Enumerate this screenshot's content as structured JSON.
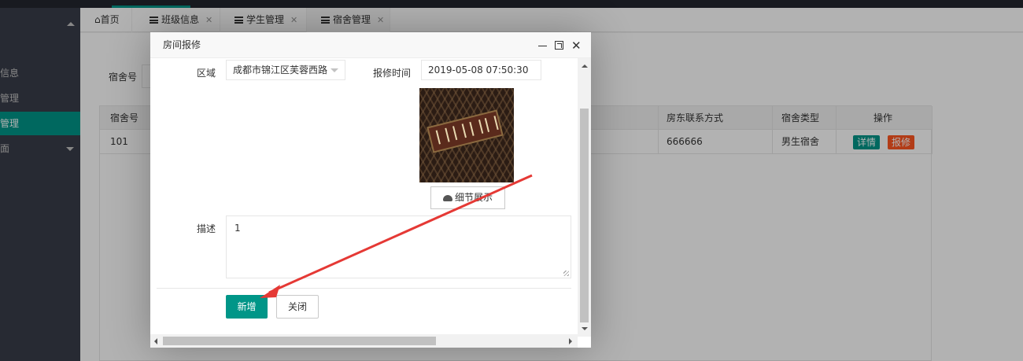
{
  "tabs": [
    {
      "label": "首页",
      "icon": "home-icon"
    },
    {
      "label": "班级信息",
      "icon": "list-icon"
    },
    {
      "label": "学生管理",
      "icon": "list-icon"
    },
    {
      "label": "宿舍管理",
      "icon": "list-icon"
    }
  ],
  "tab_close_glyph": "✕",
  "sidebar": {
    "items": [
      {
        "label": "信息"
      },
      {
        "label": "管理"
      },
      {
        "label": "管理"
      },
      {
        "label": "面"
      }
    ]
  },
  "page": {
    "search_label": "宿舍号",
    "table": {
      "headers": {
        "col1": "宿舍号",
        "col_landlord": "房东联系方式",
        "col_type": "宿舍类型",
        "col_ops": "操作"
      },
      "rows": [
        {
          "dorm_no": "101",
          "landlord_contact": "666666",
          "dorm_type": "男生宿舍",
          "detail_label": "详情",
          "repair_label": "报修"
        }
      ]
    }
  },
  "modal": {
    "title": "房间报修",
    "fields": {
      "area_label": "区域",
      "area_value": "成都市锦江区芙蓉西路",
      "time_label": "报修时间",
      "time_value": "2019-05-08 07:50:30",
      "desc_label": "描述",
      "desc_value": "1"
    },
    "detail_button": "细节展示",
    "submit_button": "新增",
    "close_button": "关闭"
  },
  "colors": {
    "primary": "#009688",
    "danger": "#ff5722",
    "annotation_arrow": "#e53935"
  }
}
